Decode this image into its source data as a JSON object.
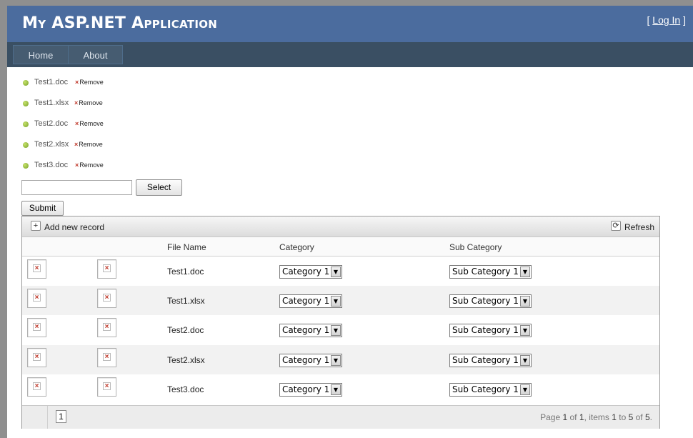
{
  "header": {
    "title": "My ASP.NET Application",
    "login_prefix": "[ ",
    "login_label": "Log In",
    "login_suffix": " ]"
  },
  "menu": {
    "items": [
      {
        "label": "Home"
      },
      {
        "label": "About"
      }
    ]
  },
  "uploads": {
    "remove_label": "Remove",
    "files": [
      {
        "name": "Test1.doc"
      },
      {
        "name": "Test1.xlsx"
      },
      {
        "name": "Test2.doc"
      },
      {
        "name": "Test2.xlsx"
      },
      {
        "name": "Test3.doc"
      }
    ],
    "select_label": "Select",
    "file_input_value": ""
  },
  "submit_label": "Submit",
  "grid": {
    "toolbar": {
      "add_label": "Add new record",
      "refresh_label": "Refresh",
      "add_icon": "plus-icon",
      "refresh_icon": "refresh-icon"
    },
    "columns": [
      "",
      "",
      "File Name",
      "Category",
      "Sub Category"
    ],
    "rows": [
      {
        "file": "Test1.doc",
        "category": "Category 1",
        "subcategory": "Sub Category 1"
      },
      {
        "file": "Test1.xlsx",
        "category": "Category 1",
        "subcategory": "Sub Category 1"
      },
      {
        "file": "Test2.doc",
        "category": "Category 1",
        "subcategory": "Sub Category 1"
      },
      {
        "file": "Test2.xlsx",
        "category": "Category 1",
        "subcategory": "Sub Category 1"
      },
      {
        "file": "Test3.doc",
        "category": "Category 1",
        "subcategory": "Sub Category 1"
      }
    ],
    "pager": {
      "current_page": "1",
      "text_page": "Page ",
      "page": "1",
      "text_of": " of ",
      "total_pages": "1",
      "text_items": ", items ",
      "item_from": "1",
      "text_to": " to ",
      "item_to": "5",
      "text_of2": " of ",
      "item_total": "5",
      "text_end": "."
    }
  },
  "colors": {
    "header_bg": "#4b6c9e",
    "menubar_bg": "#3a4f63",
    "menu_item_bg": "#465c71"
  }
}
